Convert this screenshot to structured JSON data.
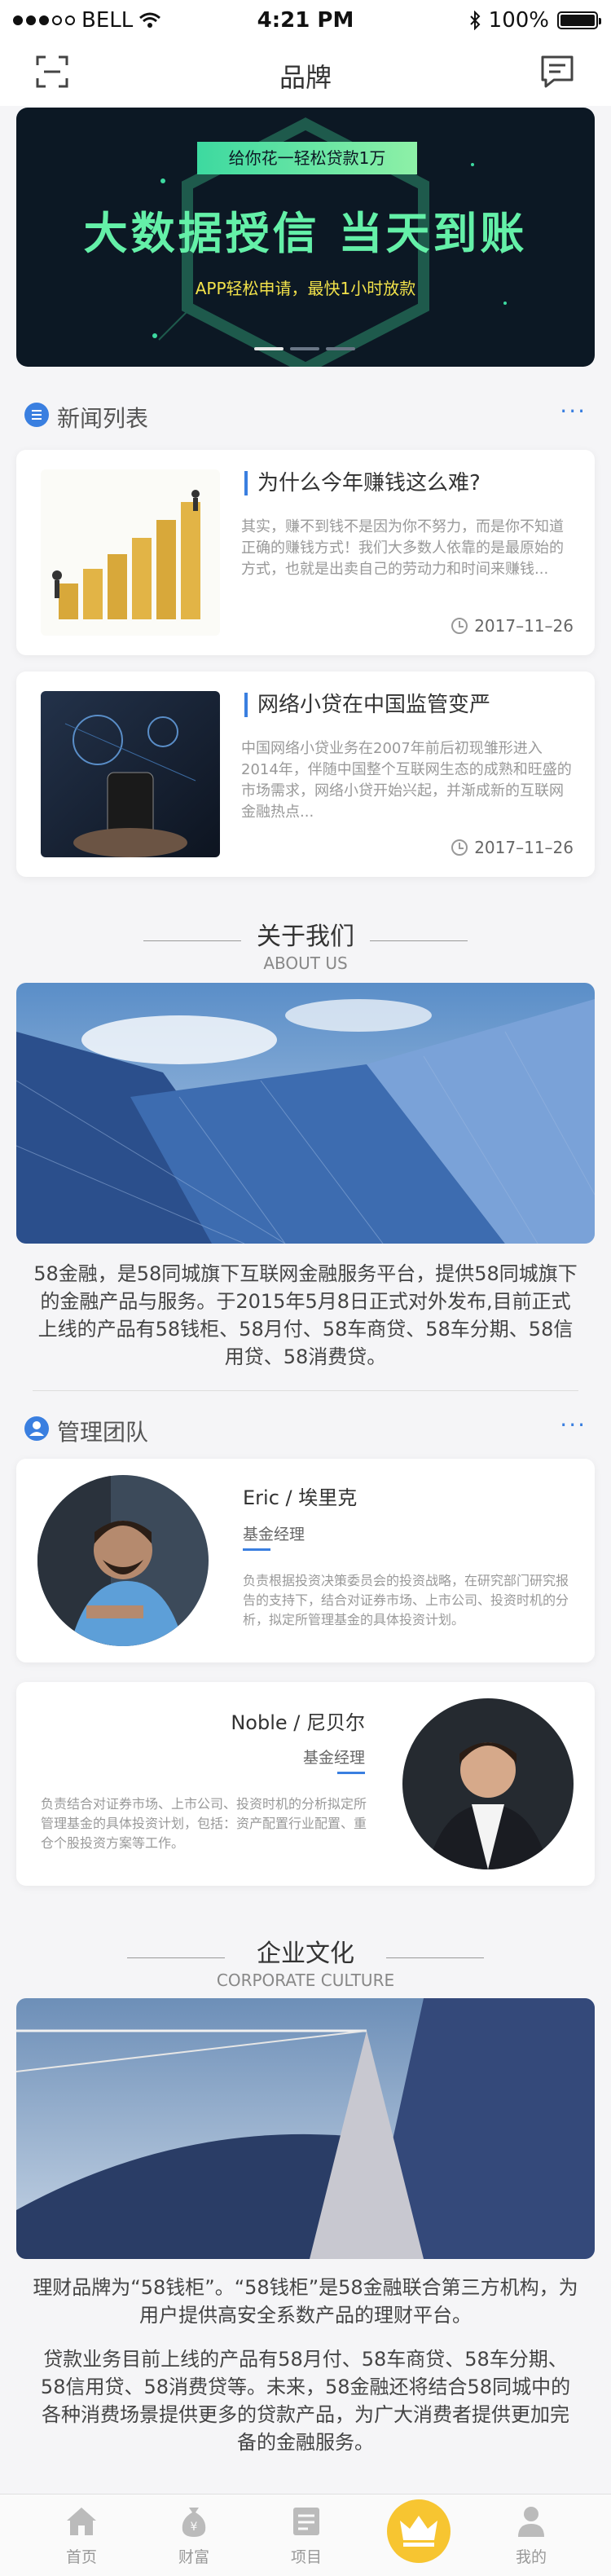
{
  "status_bar": {
    "carrier": "BELL",
    "time": "4:21 PM",
    "battery": "100%"
  },
  "navbar": {
    "title": "品牌"
  },
  "banner": {
    "pill": "给你花一轻松贷款1万",
    "headline": "大数据授信  当天到账",
    "subline": "APP轻松申请，最快1小时放款",
    "indicator_count": 3,
    "active_index": 0
  },
  "news_section": {
    "title": "新闻列表",
    "more": "···",
    "items": [
      {
        "title": "为什么今年赚钱这么难?",
        "desc": "其实，赚不到钱不是因为你不努力，而是你不知道正确的赚钱方式！我们大多数人依靠的是最原始的方式，也就是出卖自己的劳动力和时间来赚钱...",
        "date": "2017–11–26"
      },
      {
        "title": "网络小贷在中国监管变严",
        "desc": "中国网络小贷业务在2007年前后初现雏形进入2014年，伴随中国整个互联网生态的成熟和旺盛的市场需求，网络小贷开始兴起，并渐成新的互联网金融热点...",
        "date": "2017–11–26"
      }
    ]
  },
  "about": {
    "title_cn": "关于我们",
    "title_en": "ABOUT  US",
    "text": "58金融，是58同城旗下互联网金融服务平台，提供58同城旗下的金融产品与服务。于2015年5月8日正式对外发布,目前正式上线的产品有58钱柜、58月付、58车商贷、58车分期、58信用贷、58消费贷。"
  },
  "team_section": {
    "title": "管理团队",
    "more": "···",
    "members": [
      {
        "name": "Eric / 埃里克",
        "role": "基金经理",
        "desc": "负责根据投资决策委员会的投资战略，在研究部门研究报告的支持下，结合对证券市场、上市公司、投资时机的分析，拟定所管理基金的具体投资计划。"
      },
      {
        "name": "Noble / 尼贝尔",
        "role": "基金经理",
        "desc": "负责结合对证券市场、上市公司、投资时机的分析拟定所管理基金的具体投资计划，包括：资产配置行业配置、重仓个股投资方案等工作。"
      }
    ]
  },
  "culture": {
    "title_cn": "企业文化",
    "title_en": "CORPORATE CULTURE",
    "text1": "理财品牌为“58钱柜”。“58钱柜”是58金融联合第三方机构，为用户提供高安全系数产品的理财平台。",
    "text2": "贷款业务目前上线的产品有58月付、58车商贷、58车分期、58信用贷、58消费贷等。未来，58金融还将结合58同城中的各种消费场景提供更多的贷款产品，为广大消费者提供更加完备的金融服务。"
  },
  "tabbar": {
    "tabs": [
      {
        "label": "首页",
        "icon": "home-icon"
      },
      {
        "label": "财富",
        "icon": "money-bag-icon"
      },
      {
        "label": "项目",
        "icon": "project-icon"
      },
      {
        "label": "",
        "icon": "crown-icon"
      },
      {
        "label": "我的",
        "icon": "user-icon"
      }
    ]
  },
  "colors": {
    "accent": "#3a7fe0",
    "banner_green": "#64f0a8",
    "banner_yellow": "#f2e24a",
    "crown": "#f7c531"
  }
}
